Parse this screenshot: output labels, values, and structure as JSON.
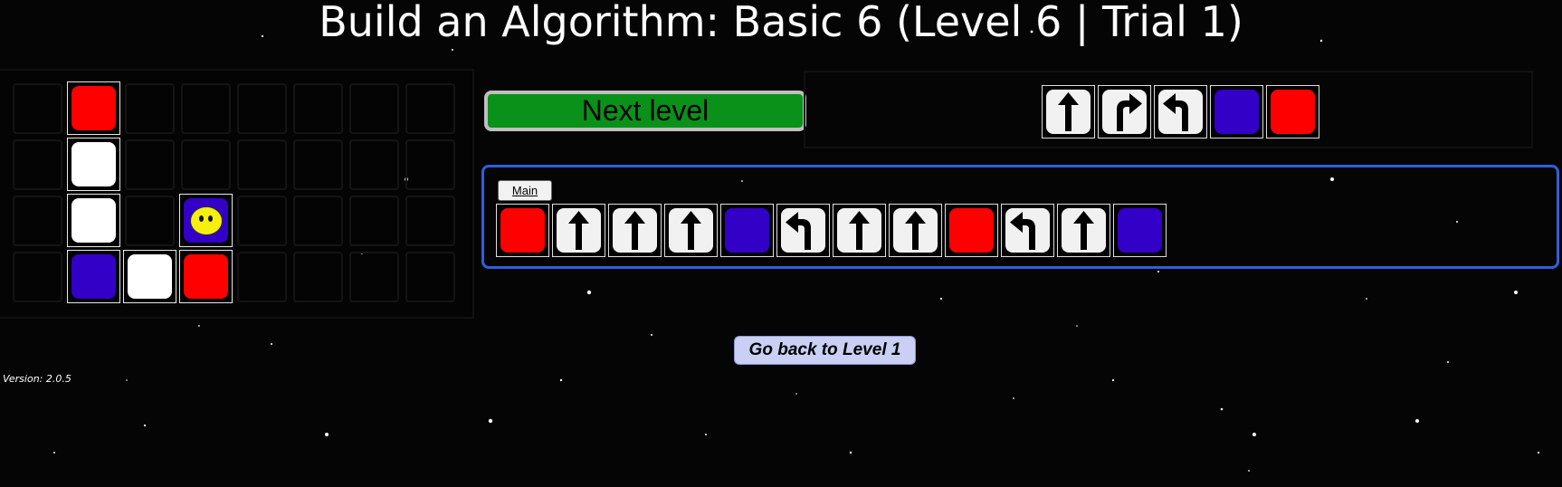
{
  "title": "Build an Algorithm: Basic 6 (Level 6 | Trial 1)",
  "colors": {
    "red": "#ff0000",
    "blue": "#3300c8",
    "white": "#ffffff",
    "next_level_green": "#0a911a",
    "main_border": "#2f5fde",
    "back_button_bg": "#c9d0f4",
    "character_yellow": "#f6f011"
  },
  "board": {
    "rows": 4,
    "cols": 8,
    "tiles": [
      {
        "row": 0,
        "col": 1,
        "color": "red"
      },
      {
        "row": 1,
        "col": 1,
        "color": "white"
      },
      {
        "row": 2,
        "col": 1,
        "color": "white"
      },
      {
        "row": 2,
        "col": 3,
        "color": "blue",
        "character": "smiley-face"
      },
      {
        "row": 3,
        "col": 1,
        "color": "blue"
      },
      {
        "row": 3,
        "col": 2,
        "color": "white"
      },
      {
        "row": 3,
        "col": 3,
        "color": "red"
      }
    ]
  },
  "next_level_label": "Next level",
  "palette": [
    {
      "type": "forward",
      "icon": "arrow-up-icon"
    },
    {
      "type": "turn-right",
      "icon": "turn-right-icon"
    },
    {
      "type": "turn-left",
      "icon": "turn-left-icon"
    },
    {
      "type": "blue",
      "icon": "blue-square-icon"
    },
    {
      "type": "red",
      "icon": "red-square-icon"
    }
  ],
  "main": {
    "tab_label": "Main",
    "program": [
      "red",
      "forward",
      "forward",
      "forward",
      "blue",
      "turn-left",
      "forward",
      "forward",
      "red",
      "turn-left",
      "forward",
      "blue"
    ]
  },
  "back_button_label": "Go back to Level 1",
  "version": "Version: 2.0.5"
}
